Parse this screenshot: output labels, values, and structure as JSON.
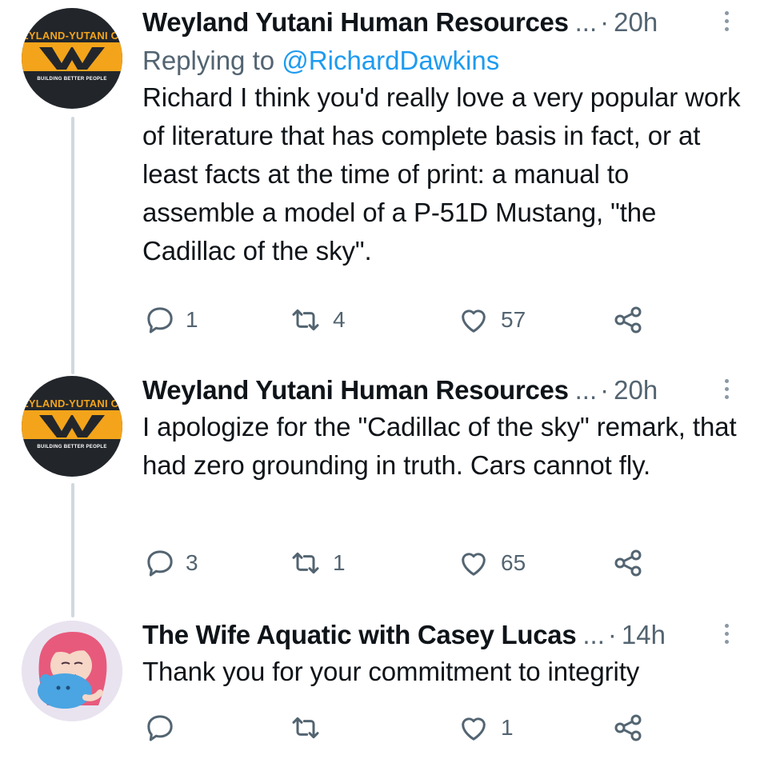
{
  "tweets": [
    {
      "author": "Weyland Yutani Human Resources",
      "ellipsis": "...",
      "separator": "·",
      "time": "20h",
      "replying_prefix": "Replying to",
      "replying_handle": "@RichardDawkins",
      "text": "Richard I think you'd really love a very popular work of literature that has complete basis in fact, or at least facts at the time of print: a manual to assemble a model of a P-51D Mustang, \"the Cadillac of the sky\".",
      "replies": "1",
      "retweets": "4",
      "likes": "57"
    },
    {
      "author": "Weyland Yutani Human Resources",
      "ellipsis": "...",
      "separator": "·",
      "time": "20h",
      "text": "I apologize for the \"Cadillac of the sky\" remark, that had zero grounding in truth. Cars cannot fly.",
      "replies": "3",
      "retweets": "1",
      "likes": "65"
    },
    {
      "author": "The Wife Aquatic with Casey Lucas",
      "ellipsis": "...",
      "separator": "·",
      "time": "14h",
      "text": "Thank you for your commitment to integrity",
      "replies": "",
      "retweets": "",
      "likes": "1"
    }
  ],
  "avatars": {
    "weyland": {
      "brand_text": "EYLAND-YUTANI CO",
      "tagline": "BUILDING BETTER PEOPLE",
      "accent": "#f3a41a",
      "bg": "#22262b"
    },
    "casey": {
      "bg": "#e6e1ee",
      "hair": "#e75a7c",
      "creature": "#4aa5e2"
    }
  },
  "icons": [
    "reply-icon",
    "retweet-icon",
    "like-icon",
    "share-icon",
    "more-options-icon"
  ],
  "colors": {
    "text": "#0f1419",
    "muted": "#536471",
    "link": "#1d9bf0",
    "thread_line": "#cfd9de"
  }
}
